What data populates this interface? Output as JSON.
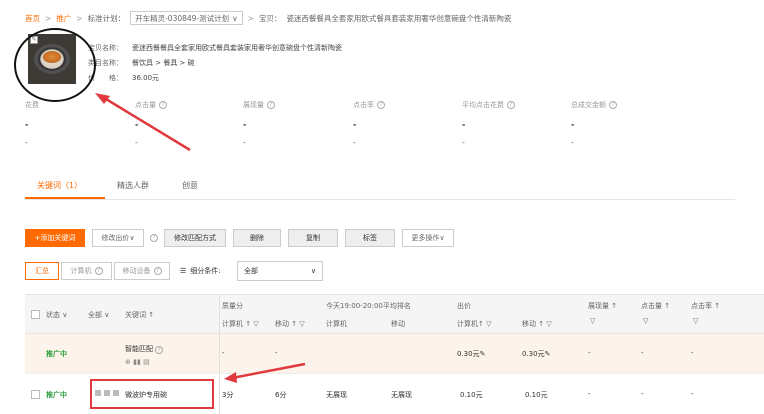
{
  "breadcrumb": {
    "home": "首页",
    "promo": "推广",
    "plan_label": "标准计划：",
    "plan_value": "开车精灵-030849-测试计划",
    "item_prefix": "宝贝：",
    "item_title": "瓷迷西餐餐具全套家用欧式餐具套装家用奢华创意碗盘个性清新陶瓷"
  },
  "product": {
    "name_label": "宝贝名称：",
    "name": "瓷迷西餐餐具全套家用欧式餐具套装家用奢华创意碗盘个性清新陶瓷",
    "category_label": "类目名称：",
    "category": "餐饮具 > 餐具 > 碗",
    "price_label": "价　　格：",
    "price": "36.00元"
  },
  "metrics": [
    {
      "label": "花费",
      "value": "-",
      "sub": "-"
    },
    {
      "label": "点击量",
      "value": "-",
      "sub": "-"
    },
    {
      "label": "展现量",
      "value": "-",
      "sub": "-"
    },
    {
      "label": "点击率",
      "value": "-",
      "sub": "-"
    },
    {
      "label": "平均点击花费",
      "value": "-",
      "sub": "-"
    },
    {
      "label": "总成交金额",
      "value": "-",
      "sub": "-"
    }
  ],
  "tabs": [
    "关键词（1）",
    "精选人群",
    "创意"
  ],
  "toolbar": {
    "add_keyword": "+添加关键词",
    "modify_bid": "修改出价",
    "modify_match": "修改匹配方式",
    "delete": "删除",
    "copy": "复制",
    "tag": "标签",
    "more": "更多操作"
  },
  "filters": {
    "summary": "汇总",
    "computer": "计算机",
    "mobile": "移动设备",
    "condition_label": "细分条件:",
    "condition_value": "全部"
  },
  "table": {
    "status": "状态",
    "all": "全部",
    "keyword": "关键词",
    "quality": "质量分",
    "q_pc": "计算机",
    "q_mobile": "移动",
    "rank": "今天19:00-20:00平均排名",
    "r_pc": "计算机",
    "r_mobile": "移动",
    "bid": "出价",
    "b_pc": "计算机",
    "b_mobile": "移动",
    "impressions": "展现量",
    "clicks": "点击量",
    "ctr": "点击率"
  },
  "rows": {
    "smart": {
      "status": "推广中",
      "keyword": "智能匹配",
      "q_pc": "-",
      "q_mobile": "-",
      "bid_pc": "0.30元",
      "bid_mobile": "0.30元",
      "impressions": "-",
      "clicks": "-",
      "ctr": "-"
    },
    "kw": {
      "status": "推广中",
      "keyword": "微波炉专用碗",
      "q_pc": "3分",
      "q_mobile": "6分",
      "r_pc": "无展现",
      "r_mobile": "无展现",
      "bid_pc": "0.10元",
      "bid_mobile": "0.10元",
      "impressions": "-",
      "clicks": "-",
      "ctr": "-"
    }
  },
  "colors": {
    "accent": "#ff6a00",
    "status_green": "#2a9d3c",
    "annotation_red": "#e0393e"
  }
}
